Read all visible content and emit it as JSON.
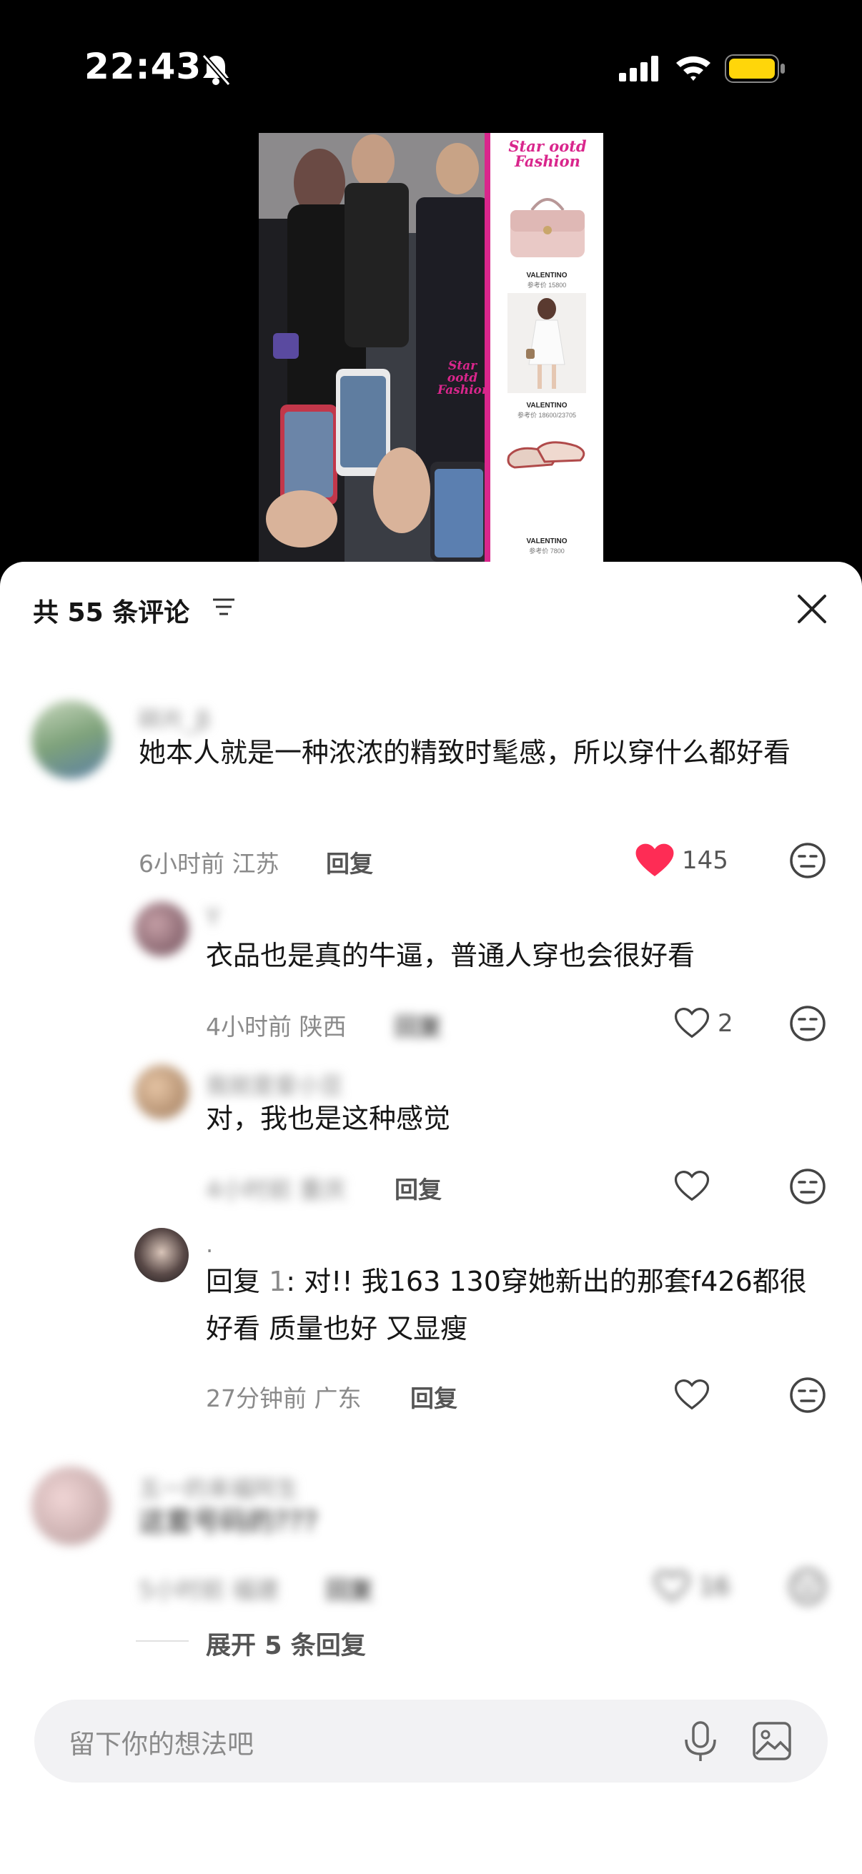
{
  "status_bar": {
    "time": "22:43",
    "battery_color": "#FFD60A"
  },
  "video": {
    "brand_line1": "Star ootd",
    "brand_line2": "Fashion",
    "products": [
      {
        "label": "VALENTINO",
        "price": "参考价 15800"
      },
      {
        "label": "VALENTINO",
        "price": "参考价 18600/23705"
      },
      {
        "label": "VALENTINO",
        "price": "参考价 7800"
      }
    ]
  },
  "comments_header": {
    "title": "共 55 条评论",
    "icons": [
      "filter-icon",
      "close-icon"
    ]
  },
  "comments": [
    {
      "name": "碎片_β",
      "text": "她本人就是一种浓浓的精致时髦感，所以穿什么都好看",
      "time": "6小时前",
      "location": "江苏",
      "reply": "回复",
      "likes": "145",
      "liked": true,
      "replies": [
        {
          "name": "Y",
          "text": "衣品也是真的牛逼，普通人穿也会很好看",
          "time": "4小时前",
          "location": "陕西",
          "reply": "回复",
          "likes": "2"
        },
        {
          "name": "我就是爱小豆",
          "text": "对，我也是这种感觉",
          "time": "4小时前",
          "location": "重庆",
          "reply": "回复",
          "likes": ""
        },
        {
          "name": ".",
          "text_prefix": "回复",
          "text_target": "1",
          "text_body": ": 对!! 我163 130穿她新出的那套f426都很好看  质量也好 又显瘦",
          "time": "27分钟前",
          "location": "广东",
          "reply": "回复",
          "likes": ""
        }
      ]
    },
    {
      "name": "五一的来福阿生",
      "text": "这套号码的???",
      "time": "5小时前",
      "location": "福建",
      "reply": "回复",
      "likes": "16",
      "expand": "展开 5 条回复"
    }
  ],
  "input": {
    "placeholder": "留下你的想法吧"
  },
  "colors": {
    "like_red": "#FE2C55",
    "sheet_bg": "#FFFFFF",
    "input_bg": "#F2F2F4"
  }
}
